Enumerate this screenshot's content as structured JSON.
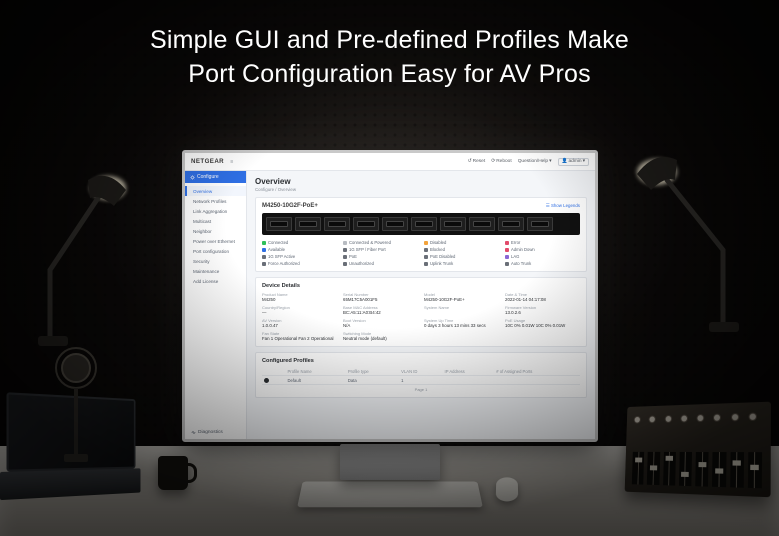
{
  "hero": {
    "line1": "Simple GUI and Pre-defined Profiles Make",
    "line2": "Port Configuration Easy for AV Pros"
  },
  "topbar": {
    "brand": "NETGEAR",
    "reset": "Reset",
    "reboot": "Reboot",
    "help": "Question/Help",
    "user": "admin"
  },
  "sidebar": {
    "configure": "Configure",
    "diagnostics": "Diagnostics",
    "items": [
      "Overview",
      "Network Profiles",
      "Link Aggregation",
      "Multicast",
      "Neighbor",
      "Power over Ethernet",
      "Port configuration",
      "Security",
      "Maintenance",
      "Add License"
    ]
  },
  "page": {
    "title": "Overview",
    "breadcrumb": "Configure / Overview",
    "model": "M4250-10G2F-PoE+",
    "legend_link": "Show Legends"
  },
  "legend": [
    {
      "color": "#2fbf5a",
      "label": "Connected"
    },
    {
      "color": "#b8bcc2",
      "label": "Connected & Powered"
    },
    {
      "color": "#f2a33c",
      "label": "Disabled"
    },
    {
      "color": "#e24b6b",
      "label": "Error"
    },
    {
      "color": "#2f6fe4",
      "label": "Available"
    },
    {
      "color": "#6a6f78",
      "label": "1G SFP / Fiber Port"
    },
    {
      "color": "#6a6f78",
      "label": "Blocked"
    },
    {
      "color": "#e24b6b",
      "label": "Admin Down"
    },
    {
      "color": "#6a6f78",
      "label": "1G SFP Active"
    },
    {
      "color": "#6a6f78",
      "label": "PoE"
    },
    {
      "color": "#6a6f78",
      "label": "PoE Disabled"
    },
    {
      "color": "#8a66d4",
      "label": "LAG"
    },
    {
      "color": "#6a6f78",
      "label": "Force Authorized"
    },
    {
      "color": "#6a6f78",
      "label": "Unauthorized"
    },
    {
      "color": "#6a6f78",
      "label": "Uplink Trunk"
    },
    {
      "color": "#6a6f78",
      "label": "Auto Trunk"
    }
  ],
  "details": {
    "title": "Device Details",
    "rows": [
      {
        "k": "Product Name",
        "v": "M4250"
      },
      {
        "k": "Serial Number",
        "v": "65M17C5A001F5"
      },
      {
        "k": "Model",
        "v": "M4250-10G2F-PoE+"
      },
      {
        "k": "Date & Time",
        "v": "2022-01-14 04:17:08"
      },
      {
        "k": "Country/Region",
        "v": "—"
      },
      {
        "k": "Base MAC Address",
        "v": "BC:A5:11:A0:B4:42"
      },
      {
        "k": "System Name",
        "v": ""
      },
      {
        "k": "Firmware Version",
        "v": "13.0.2.6"
      },
      {
        "k": "AV Version",
        "v": "1.0.0.47"
      },
      {
        "k": "Boot Version",
        "v": "N/A"
      },
      {
        "k": "System Up Time",
        "v": "0 days 3 hours 13 mins 33 secs"
      },
      {
        "k": "PoE Usage",
        "v": "10C 0% 0.01W  10C 0% 0.01W"
      },
      {
        "k": "Fan State",
        "v": "Fan 1 Operational  Fan 2 Operational"
      },
      {
        "k": "Switching Mode",
        "v": "Neutral mode (default)"
      }
    ]
  },
  "profiles": {
    "title": "Configured Profiles",
    "headers": [
      "",
      "Profile Name",
      "Profile type",
      "VLAN ID",
      "IP Address",
      "# of Assigned Ports"
    ],
    "rows": [
      {
        "sel": true,
        "name": "Default",
        "type": "Data",
        "vlan": "1",
        "ip": "",
        "ports": ""
      }
    ],
    "pager": "Page 1"
  }
}
